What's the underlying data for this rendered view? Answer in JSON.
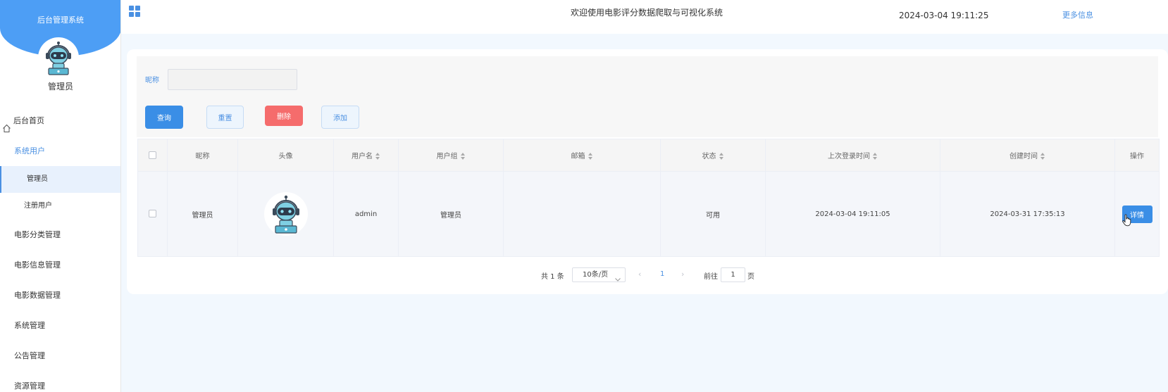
{
  "sidebar": {
    "title": "后台管理系统",
    "user_name": "管理员",
    "menu": {
      "home": "后台首页",
      "system_users": "系统用户",
      "admin": "管理员",
      "registered": "注册用户",
      "category": "电影分类管理",
      "info": "电影信息管理",
      "data": "电影数据管理",
      "system": "系统管理",
      "notice": "公告管理",
      "resource": "资源管理"
    }
  },
  "topbar": {
    "welcome": "欢迎使用电影评分数据爬取与可视化系统",
    "datetime": "2024-03-04 19:11:25",
    "more": "更多信息"
  },
  "filter": {
    "nickname_label": "昵称",
    "nickname_value": "",
    "query": "查询",
    "reset": "重置",
    "delete": "删除",
    "add": "添加"
  },
  "table": {
    "headers": {
      "nickname": "昵称",
      "avatar": "头像",
      "username": "用户名",
      "group": "用户组",
      "email": "邮箱",
      "status": "状态",
      "last_login": "上次登录时间",
      "created": "创建时间",
      "actions": "操作"
    },
    "rows": [
      {
        "nickname": "管理员",
        "username": "admin",
        "group": "管理员",
        "email": "",
        "status": "可用",
        "last_login": "2024-03-04 19:11:05",
        "created": "2024-03-31 17:35:13",
        "detail": "详情"
      }
    ]
  },
  "pagination": {
    "total": "共 1 条",
    "page_size": "10条/页",
    "current": "1",
    "goto": "前往",
    "jump_value": "1",
    "page": "页"
  },
  "colors": {
    "primary": "#3a8ee6",
    "danger": "#f56c6c",
    "header_blue": "#4d9ef5",
    "background": "#f2f8fe"
  },
  "icons": [
    "home-icon",
    "grid-icon",
    "robot-avatar-icon",
    "sort-icon",
    "chevron-down-icon",
    "hand-cursor-icon"
  ]
}
